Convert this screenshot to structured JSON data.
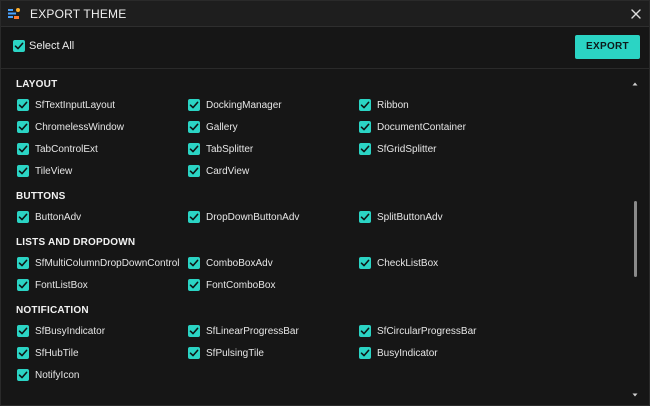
{
  "window": {
    "title": "EXPORT THEME",
    "icons": {
      "app": "app-logo-icon",
      "close": "close-icon"
    }
  },
  "toolbar": {
    "select_all": {
      "label": "Select All",
      "checked": true
    },
    "export_label": "EXPORT"
  },
  "colors": {
    "accent": "#2bd4c4",
    "background": "#161616",
    "titlebar": "#1e1e1e"
  },
  "sections": [
    {
      "title": "LAYOUT",
      "items": [
        "SfTextInputLayout",
        "DockingManager",
        "Ribbon",
        "ChromelessWindow",
        "Gallery",
        "DocumentContainer",
        "TabControlExt",
        "TabSplitter",
        "SfGridSplitter",
        "TileView",
        "CardView"
      ]
    },
    {
      "title": "BUTTONS",
      "items": [
        "ButtonAdv",
        "DropDownButtonAdv",
        "SplitButtonAdv"
      ]
    },
    {
      "title": "LISTS AND DROPDOWN",
      "items": [
        "SfMultiColumnDropDownControl",
        "ComboBoxAdv",
        "CheckListBox",
        "FontListBox",
        "FontComboBox"
      ]
    },
    {
      "title": "NOTIFICATION",
      "items": [
        "SfBusyIndicator",
        "SfLinearProgressBar",
        "SfCircularProgressBar",
        "SfHubTile",
        "SfPulsingTile",
        "BusyIndicator",
        "NotifyIcon"
      ]
    }
  ]
}
